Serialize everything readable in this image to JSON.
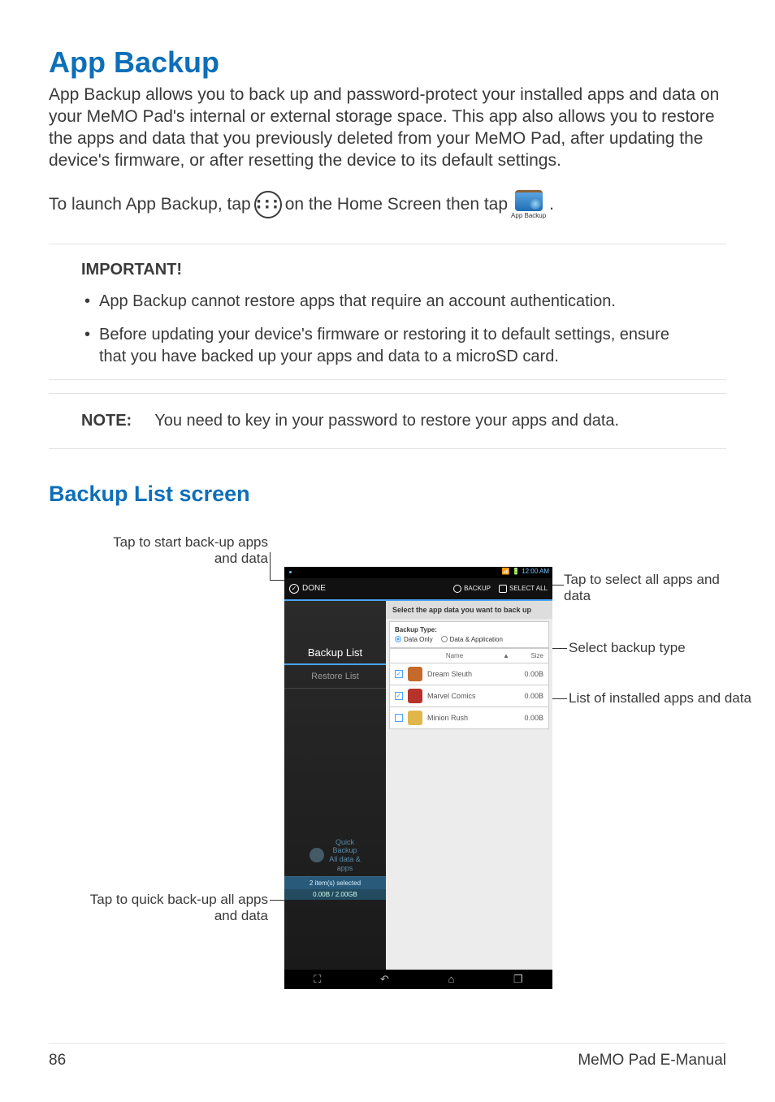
{
  "title": "App Backup",
  "intro": "App Backup allows you to back up and password-protect your installed apps and data on your MeMO Pad's internal or external storage space. This app also allows you to restore the apps and data that you previously deleted from your MeMO Pad, after updating the device's firmware, or after resetting the device to its default settings.",
  "launch_pre": "To launch App Backup, tap",
  "launch_mid": "on the Home Screen then tap",
  "launch_post": ".",
  "appbk_caption": "App Backup",
  "important_title": "IMPORTANT!",
  "important_items": [
    "App Backup cannot restore apps that require an account authentication.",
    "Before updating your device's firmware or restoring it to default settings, ensure that you have backed up your apps and data to a microSD card."
  ],
  "note_label": "NOTE:",
  "note_text": "You need to key in your password to restore your apps and data.",
  "subheading": "Backup List screen",
  "callouts": {
    "start": "Tap to start back-up apps and data",
    "selectall": "Tap to select all apps and data",
    "backup_type": "Select backup type",
    "list": "List of installed apps and data",
    "quick": "Tap to quick back-up all apps and data"
  },
  "device": {
    "status_time": "12:00 AM",
    "done": "DONE",
    "backup_btn": "BACKUP",
    "selectall_btn": "SELECT ALL",
    "sidebar": {
      "backup_list": "Backup List",
      "restore_list": "Restore List",
      "quick_l1": "Quick",
      "quick_l2": "Backup",
      "quick_l3": "All data &",
      "quick_l4": "apps",
      "selected": "2 item(s) selected",
      "free": "0.00B / 2.00GB"
    },
    "banner": "Select the app data you want to back up",
    "backup_type_label": "Backup Type:",
    "opt_data_only": "Data Only",
    "opt_data_app": "Data & Application",
    "col_name": "Name",
    "col_size": "Size",
    "apps": [
      {
        "name": "Dream Sleuth",
        "size": "0.00B",
        "checked": true,
        "color": "#c46a2a"
      },
      {
        "name": "Marvel Comics",
        "size": "0.00B",
        "checked": true,
        "color": "#b5332a"
      },
      {
        "name": "Minion Rush",
        "size": "0.00B",
        "checked": false,
        "color": "#e0b74a"
      }
    ]
  },
  "footer": {
    "page": "86",
    "title": "MeMO Pad E-Manual"
  }
}
